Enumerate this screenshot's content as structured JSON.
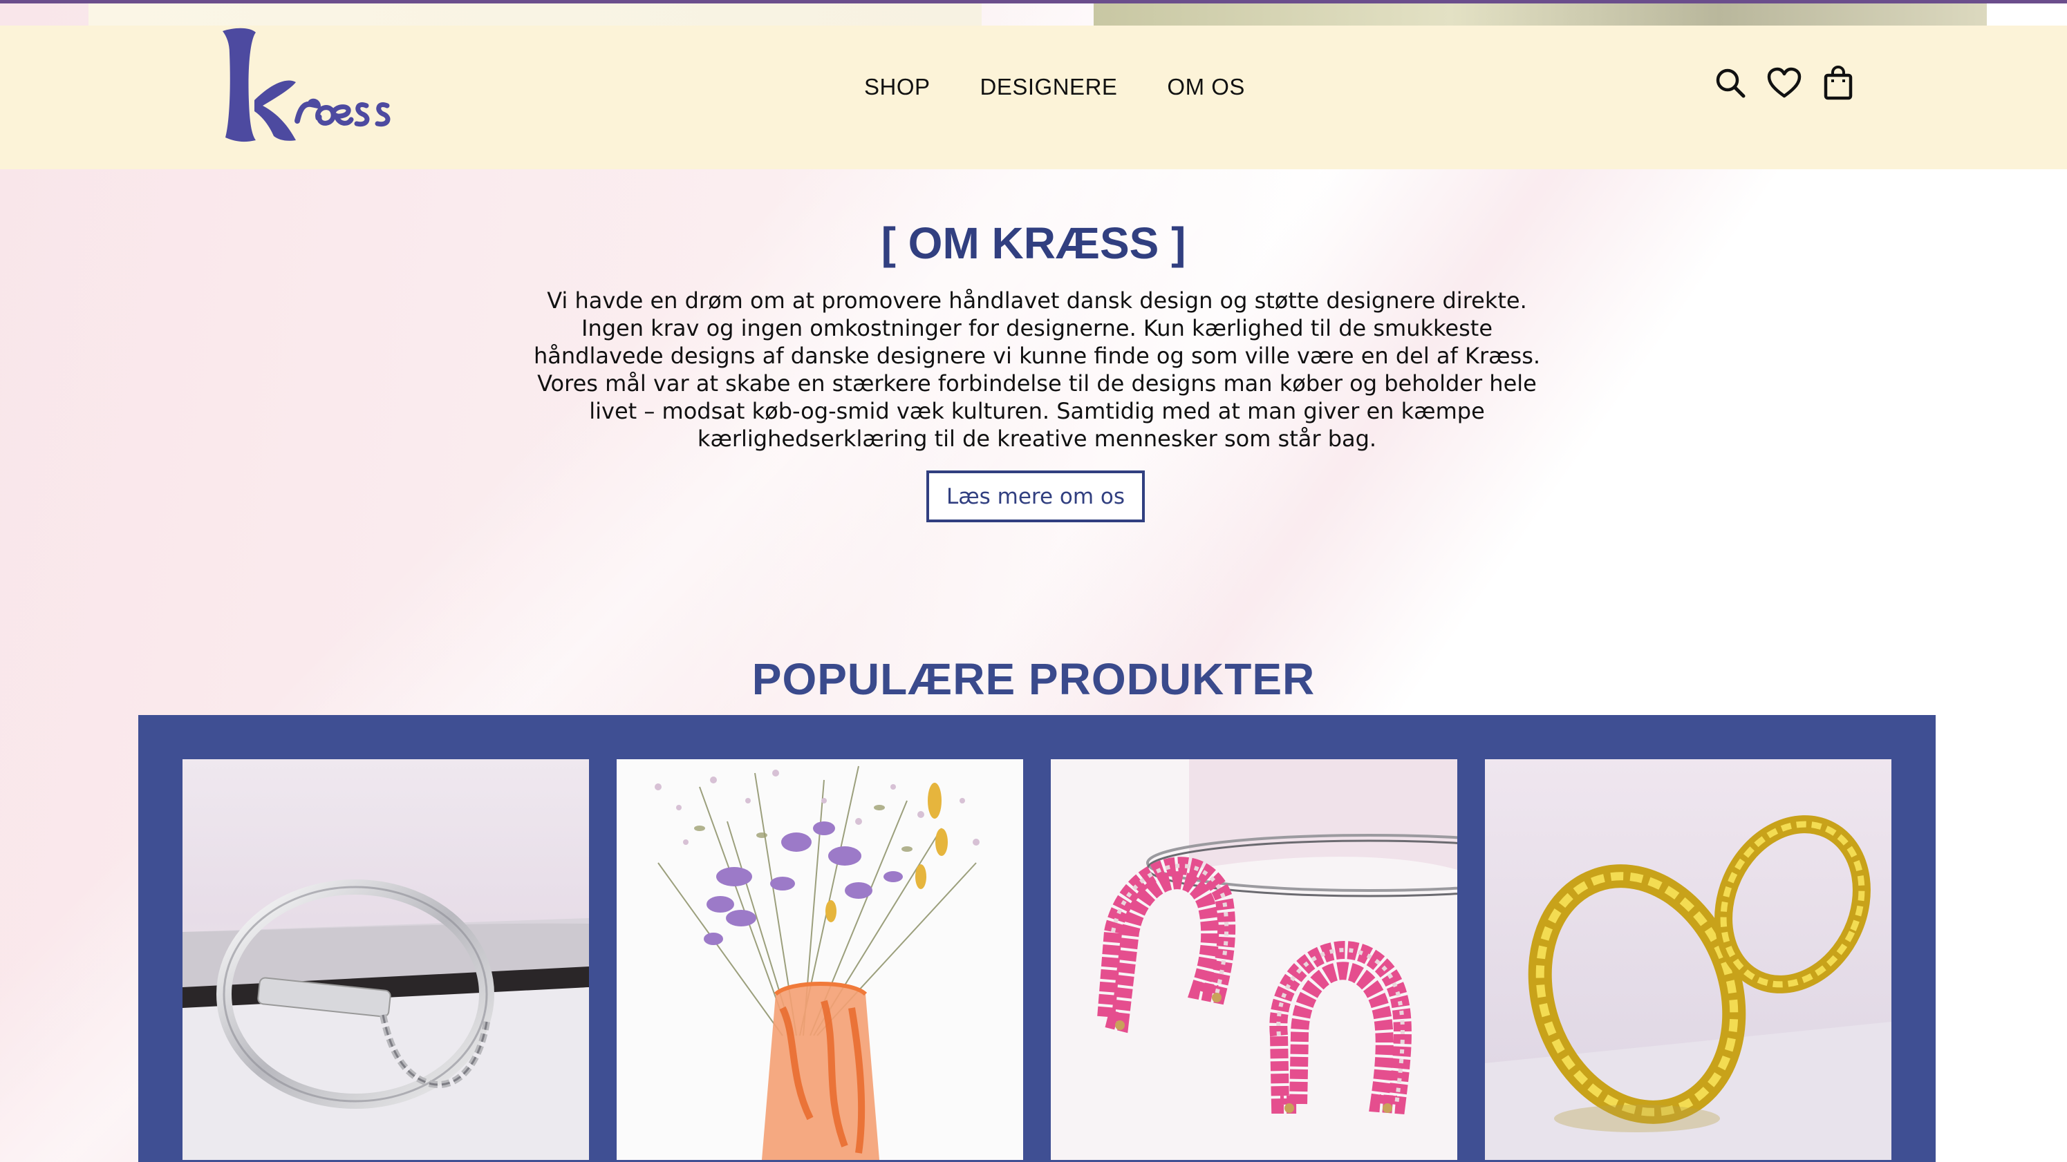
{
  "brand": {
    "logo_text": "Kræss",
    "logo_color": "#4d4aa0"
  },
  "nav": {
    "items": [
      "SHOP",
      "DESIGNERE",
      "OM OS"
    ]
  },
  "header_icons": [
    "search-icon",
    "heart-icon",
    "shopping-bag-icon"
  ],
  "about": {
    "title": "[ OM KRÆSS ]",
    "text": "Vi havde en drøm om at promovere håndlavet dansk design og støtte designere direkte. Ingen krav og ingen omkostninger for designerne. Kun kærlighed til de smukkeste håndlavede designs af danske designere vi kunne finde og som ville være en del af Kræss. Vores mål var at skabe en stærkere forbindelse til de designs man køber og beholder hele livet – modsat køb-og-smid væk kulturen. Samtidig med at man giver en kæmpe kærlighedserklæring til de kreative mennesker som står bag.",
    "button_label": "Læs mere om os"
  },
  "popular": {
    "title": "POPULÆRE PRODUKTER",
    "products": [
      {
        "image": "silver-bracelet-with-chain"
      },
      {
        "image": "dried-flowers-in-orange-vase"
      },
      {
        "image": "pink-rhinestone-arch-earrings"
      },
      {
        "image": "gold-hoop-earrings"
      }
    ]
  },
  "colors": {
    "accent": "#313f80",
    "header_bg": "#fcf3d8",
    "panel_bg": "#3f4f93"
  }
}
